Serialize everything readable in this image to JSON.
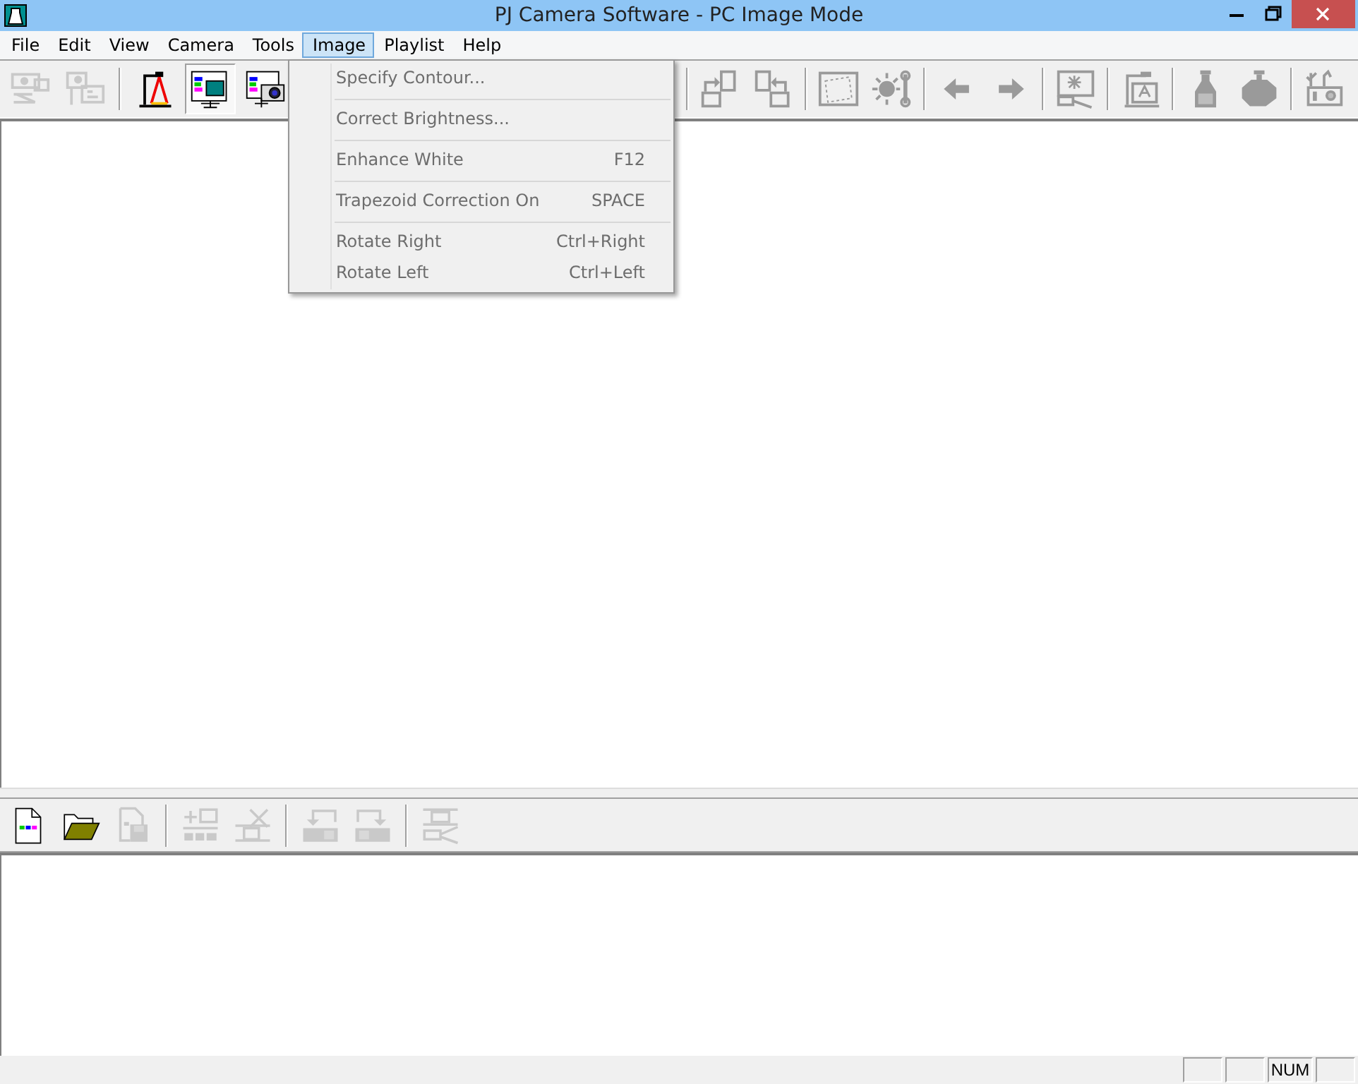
{
  "window": {
    "title": "PJ Camera Software - PC Image Mode"
  },
  "menu_bar": [
    {
      "label": "File",
      "selected": false
    },
    {
      "label": "Edit",
      "selected": false
    },
    {
      "label": "View",
      "selected": false
    },
    {
      "label": "Camera",
      "selected": false
    },
    {
      "label": "Tools",
      "selected": false
    },
    {
      "label": "Image",
      "selected": true
    },
    {
      "label": "Playlist",
      "selected": false
    },
    {
      "label": "Help",
      "selected": false
    }
  ],
  "image_menu": [
    {
      "kind": "item",
      "label": "Specify Contour...",
      "disabled": true
    },
    {
      "kind": "separator"
    },
    {
      "kind": "item",
      "label": "Correct Brightness...",
      "disabled": true
    },
    {
      "kind": "separator"
    },
    {
      "kind": "item",
      "label": "Enhance White",
      "shortcut": "F12",
      "disabled": true
    },
    {
      "kind": "separator"
    },
    {
      "kind": "item",
      "label": "Trapezoid Correction On",
      "shortcut": "SPACE",
      "disabled": true
    },
    {
      "kind": "separator"
    },
    {
      "kind": "item",
      "label": "Rotate Right",
      "shortcut": "Ctrl+Right",
      "disabled": true
    },
    {
      "kind": "item",
      "label": "Rotate Left",
      "shortcut": "Ctrl+Left",
      "disabled": true
    }
  ],
  "main_toolbar": {
    "left": [
      {
        "kind": "projector",
        "disabled": true,
        "selected": false
      },
      {
        "kind": "easel",
        "disabled": true,
        "selected": false
      },
      {
        "kind": "separator"
      },
      {
        "kind": "stand",
        "disabled": false,
        "selected": false
      },
      {
        "kind": "monitor",
        "disabled": false,
        "selected": true
      },
      {
        "kind": "camera",
        "disabled": false,
        "selected": false
      }
    ],
    "right": [
      {
        "kind": "separator"
      },
      {
        "kind": "rotateright",
        "disabled": true,
        "selected": false
      },
      {
        "kind": "rotateleft",
        "disabled": true,
        "selected": false
      },
      {
        "kind": "separator"
      },
      {
        "kind": "trapezoid",
        "disabled": true,
        "selected": false
      },
      {
        "kind": "brightness",
        "disabled": true,
        "selected": false
      },
      {
        "kind": "separator"
      },
      {
        "kind": "arrowleft",
        "disabled": true,
        "selected": false
      },
      {
        "kind": "arrowright",
        "disabled": true,
        "selected": false
      },
      {
        "kind": "separator"
      },
      {
        "kind": "spotlight",
        "disabled": true,
        "selected": false
      },
      {
        "kind": "separator"
      },
      {
        "kind": "document",
        "disabled": true,
        "selected": false
      },
      {
        "kind": "separator"
      },
      {
        "kind": "bottle",
        "disabled": true,
        "selected": false
      },
      {
        "kind": "blob",
        "disabled": true,
        "selected": false
      },
      {
        "kind": "separator"
      },
      {
        "kind": "antenna",
        "disabled": true,
        "selected": false
      }
    ]
  },
  "playlist_toolbar": [
    {
      "kind": "newfile",
      "disabled": false,
      "selected": false
    },
    {
      "kind": "folder",
      "disabled": false,
      "selected": false
    },
    {
      "kind": "savefile",
      "disabled": true,
      "selected": false
    },
    {
      "kind": "separator"
    },
    {
      "kind": "addslide",
      "disabled": true,
      "selected": false
    },
    {
      "kind": "deleteslide",
      "disabled": true,
      "selected": false
    },
    {
      "kind": "separator"
    },
    {
      "kind": "moveleft",
      "disabled": true,
      "selected": false
    },
    {
      "kind": "moveright",
      "disabled": true,
      "selected": false
    },
    {
      "kind": "separator"
    },
    {
      "kind": "projectslide",
      "disabled": true,
      "selected": false
    }
  ],
  "status_bar": {
    "indicator": "NUM"
  }
}
